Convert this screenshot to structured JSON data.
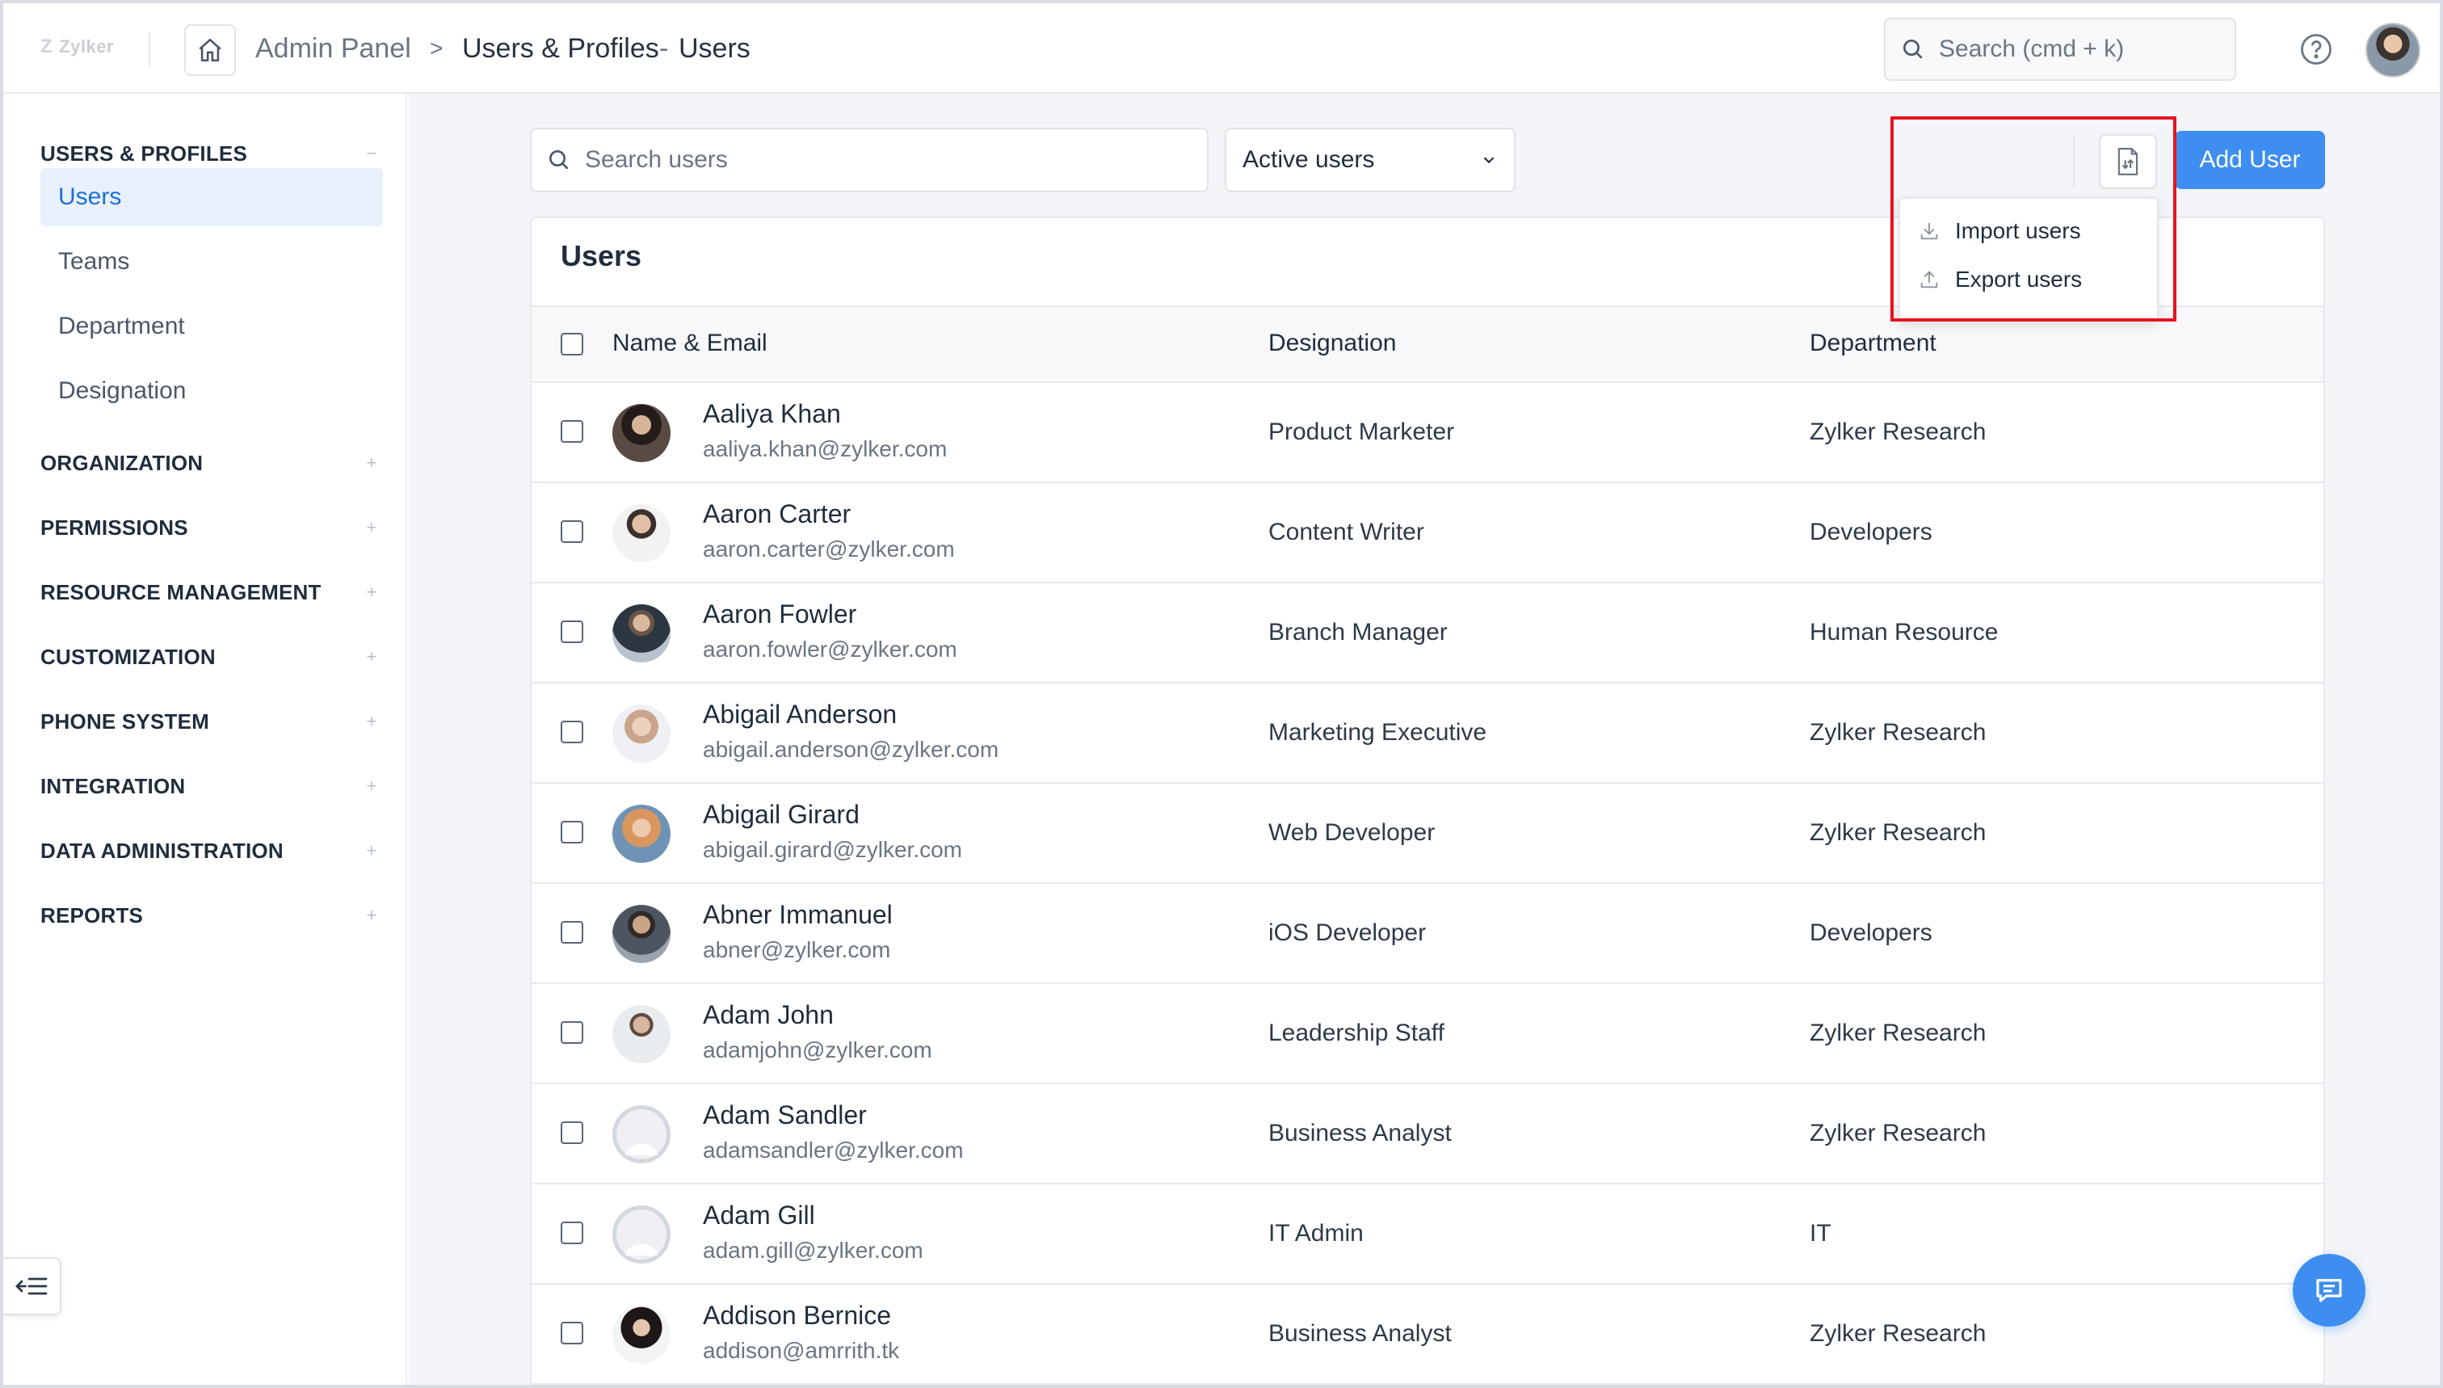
{
  "header": {
    "logo_text": "Zylker",
    "breadcrumb": {
      "admin": "Admin Panel",
      "separator": ">",
      "section": "Users & Profiles",
      "dash": "-",
      "page": "Users"
    },
    "search_placeholder": "Search (cmd + k)"
  },
  "sidebar": {
    "sections": [
      {
        "label": "USERS & PROFILES",
        "toggle": "−",
        "expanded": true
      },
      {
        "label": "ORGANIZATION",
        "toggle": "+"
      },
      {
        "label": "PERMISSIONS",
        "toggle": "+"
      },
      {
        "label": "RESOURCE MANAGEMENT",
        "toggle": "+"
      },
      {
        "label": "CUSTOMIZATION",
        "toggle": "+"
      },
      {
        "label": "PHONE SYSTEM",
        "toggle": "+"
      },
      {
        "label": "INTEGRATION",
        "toggle": "+"
      },
      {
        "label": "DATA ADMINISTRATION",
        "toggle": "+"
      },
      {
        "label": "REPORTS",
        "toggle": "+"
      }
    ],
    "items": [
      {
        "label": "Users",
        "active": true
      },
      {
        "label": "Teams"
      },
      {
        "label": "Department"
      },
      {
        "label": "Designation"
      }
    ]
  },
  "toolbar": {
    "search_placeholder": "Search users",
    "status_filter": "Active users",
    "add_user_label": "Add User",
    "menu": {
      "import_label": "Import users",
      "export_label": "Export users"
    }
  },
  "table": {
    "title": "Users",
    "columns": [
      "Name & Email",
      "Designation",
      "Department"
    ],
    "rows": [
      {
        "name": "Aaliya Khan",
        "email": "aaliya.khan@zylker.com",
        "designation": "Product Marketer",
        "department": "Zylker Research"
      },
      {
        "name": "Aaron Carter",
        "email": "aaron.carter@zylker.com",
        "designation": "Content Writer",
        "department": "Developers"
      },
      {
        "name": "Aaron Fowler",
        "email": "aaron.fowler@zylker.com",
        "designation": "Branch Manager",
        "department": "Human Resource"
      },
      {
        "name": "Abigail Anderson",
        "email": "abigail.anderson@zylker.com",
        "designation": "Marketing Executive",
        "department": "Zylker Research"
      },
      {
        "name": "Abigail Girard",
        "email": "abigail.girard@zylker.com",
        "designation": "Web Developer",
        "department": "Zylker Research"
      },
      {
        "name": "Abner Immanuel",
        "email": "abner@zylker.com",
        "designation": "iOS Developer",
        "department": "Developers"
      },
      {
        "name": "Adam John",
        "email": "adamjohn@zylker.com",
        "designation": "Leadership Staff",
        "department": "Zylker Research"
      },
      {
        "name": "Adam Sandler",
        "email": "adamsandler@zylker.com",
        "designation": "Business Analyst",
        "department": "Zylker Research"
      },
      {
        "name": "Adam Gill",
        "email": "adam.gill@zylker.com",
        "designation": "IT Admin",
        "department": "IT"
      },
      {
        "name": "Addison Bernice",
        "email": "addison@amrrith.tk",
        "designation": "Business Analyst",
        "department": "Zylker Research"
      }
    ]
  },
  "colors": {
    "accent": "#3d8ef0",
    "active_bg": "#e8f1fb",
    "highlight": "#e8131f"
  },
  "icons": {
    "home": "home-icon",
    "search": "search-icon",
    "help": "help-icon",
    "chevron": "chevron-down-icon",
    "file": "file-transfer-icon",
    "import": "download-icon",
    "export": "upload-icon",
    "collapse": "collapse-sidebar-icon",
    "chat": "chat-icon"
  }
}
